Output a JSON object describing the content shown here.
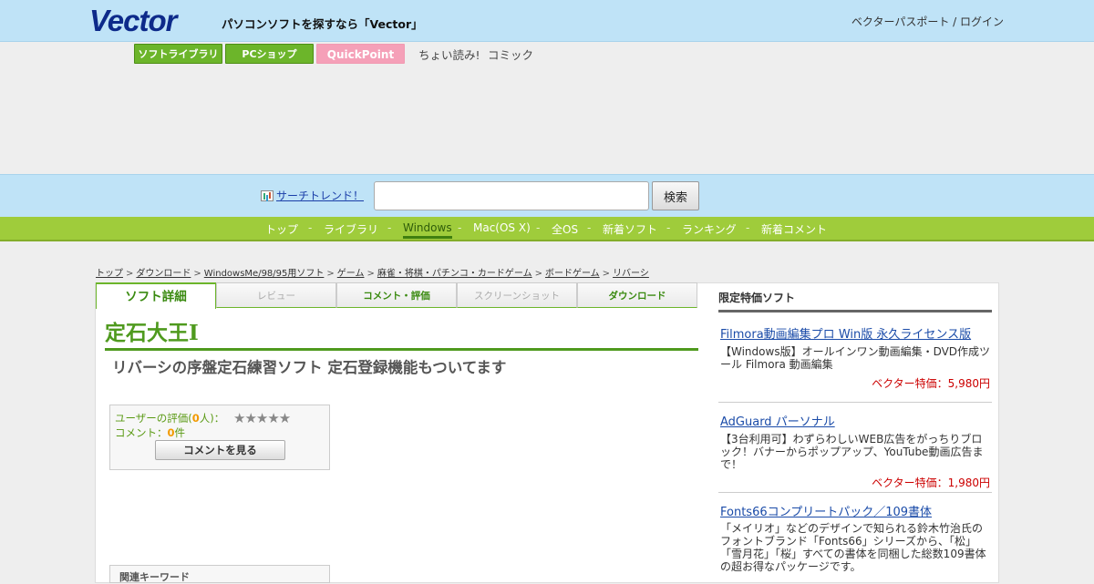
{
  "header": {
    "logo_text": "Vector",
    "tagline": "パソコンソフトを探すなら「Vector」",
    "login": "ベクターパスポート / ログイン"
  },
  "services": [
    "ソフトライブラリ",
    "PCショップ",
    "QuickPoint"
  ],
  "extra_links": [
    "ちょい読み!",
    "コミック"
  ],
  "search": {
    "trend_label": "サーチトレンド！",
    "placeholder": "",
    "button": "検索"
  },
  "nav": {
    "items": [
      "トップ",
      "ライブラリ",
      "Windows",
      "Mac(OS X)",
      "全OS",
      "新着ソフト",
      "ランキング",
      "新着コメント"
    ],
    "active": "Windows",
    "separator": "-"
  },
  "breadcrumb": [
    "トップ",
    "ダウンロード",
    "WindowsMe/98/95用ソフト",
    "ゲーム",
    "麻雀・将棋・パチンコ・カードゲーム",
    "ボードゲーム",
    "リバーシ"
  ],
  "breadcrumb_sep": ">",
  "tabs": [
    "ソフト詳細",
    "レビュー",
    "コメント・評価",
    "スクリーンショット",
    "ダウンロード"
  ],
  "software": {
    "title": "定石大王I",
    "subtitle": "リバーシの序盤定石練習ソフト 定石登録機能もついてます"
  },
  "rating": {
    "user_label": "ユーザーの評価(",
    "user_count": "0",
    "user_suffix": "人)：",
    "stars": "★★★★★",
    "comment_label": "コメント：",
    "comment_count": "0",
    "comment_suffix": "件",
    "button": "コメントを見る"
  },
  "related": {
    "heading": "関連キーワード"
  },
  "sidebar": {
    "heading": "限定特価ソフト",
    "ads": [
      {
        "title": "Filmora動画編集プロ Win版 永久ライセンス版",
        "desc": "【Windows版】オールインワン動画編集・DVD作成ツール Filmora 動画編集",
        "price": "ベクター特価：5,980円"
      },
      {
        "title": "AdGuard パーソナル",
        "desc": "【3台利用可】わずらわしいWEB広告をがっちりブロック！バナーからポップアップ、YouTube動画広告まで！",
        "price": "ベクター特価：1,980円"
      },
      {
        "title": "Fonts66コンプリートパック／109書体",
        "desc": "「メイリオ」などのデザインで知られる鈴木竹治氏のフォントブランド「Fonts66」シリーズから、「松」「雪月花」「桜」すべての書体を同梱した総数109書体の超お得なパッケージです。",
        "price": ""
      }
    ]
  },
  "colors": {
    "header_bg": "#bfe3f7",
    "nav_green": "#9fcc3b",
    "title_green": "#4f9a1e",
    "link_blue": "#1a4ba8",
    "price_red": "#cc0000"
  }
}
